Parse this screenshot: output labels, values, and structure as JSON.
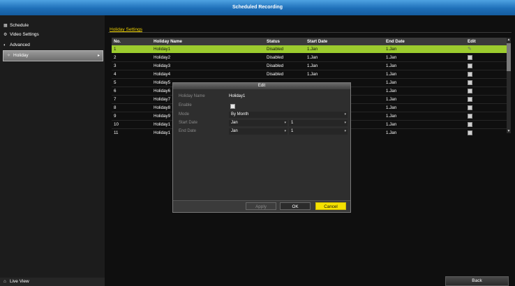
{
  "window": {
    "title": "Scheduled Recording"
  },
  "sidebar": {
    "items": [
      {
        "label": "Schedule",
        "icon": "calendar-icon",
        "glyph": "▦",
        "active": false
      },
      {
        "label": "Video Settings",
        "icon": "gear-icon",
        "glyph": "⚙",
        "active": false
      },
      {
        "label": "Advanced",
        "icon": "advanced-icon",
        "glyph": "◐",
        "active": false
      },
      {
        "label": "Holiday",
        "icon": "holiday-icon",
        "glyph": "✧",
        "active": true,
        "arrow": "▸"
      }
    ],
    "live_view": {
      "label": "Live View",
      "icon": "home-icon",
      "glyph": "⌂"
    }
  },
  "main": {
    "section_title": "Holiday Settings",
    "table": {
      "headers": [
        "No.",
        "Holiday Name",
        "Status",
        "Start Date",
        "End Date",
        "Edit"
      ],
      "rows": [
        {
          "no": "1",
          "name": "Holiday1",
          "status": "Disabled",
          "start": "1.Jan",
          "end": "1.Jan",
          "selected": true
        },
        {
          "no": "2",
          "name": "Holiday2",
          "status": "Disabled",
          "start": "1.Jan",
          "end": "1.Jan"
        },
        {
          "no": "3",
          "name": "Holiday3",
          "status": "Disabled",
          "start": "1.Jan",
          "end": "1.Jan"
        },
        {
          "no": "4",
          "name": "Holiday4",
          "status": "Disabled",
          "start": "1.Jan",
          "end": "1.Jan"
        },
        {
          "no": "5",
          "name": "Holiday5",
          "status": "",
          "start": "",
          "end": "1.Jan"
        },
        {
          "no": "6",
          "name": "Holiday6",
          "status": "",
          "start": "",
          "end": "1.Jan"
        },
        {
          "no": "7",
          "name": "Holiday7",
          "status": "",
          "start": "",
          "end": "1.Jan"
        },
        {
          "no": "8",
          "name": "Holiday8",
          "status": "",
          "start": "",
          "end": "1.Jan"
        },
        {
          "no": "9",
          "name": "Holiday9",
          "status": "",
          "start": "",
          "end": "1.Jan"
        },
        {
          "no": "10",
          "name": "Holiday1",
          "status": "",
          "start": "",
          "end": "1.Jan"
        },
        {
          "no": "11",
          "name": "Holiday1",
          "status": "",
          "start": "",
          "end": "1.Jan"
        }
      ]
    },
    "back_label": "Back"
  },
  "dialog": {
    "title": "Edit",
    "fields": {
      "holiday_name_label": "Holiday Name",
      "holiday_name_value": "Holiday1",
      "enable_label": "Enable",
      "mode_label": "Mode",
      "mode_value": "By Month",
      "start_date_label": "Start Date",
      "start_month": "Jan",
      "start_day": "1",
      "end_date_label": "End Date",
      "end_month": "Jan",
      "end_day": "1"
    },
    "buttons": {
      "apply": "Apply",
      "ok": "OK",
      "cancel": "Cancel"
    }
  },
  "colors": {
    "title_bar": "#1e6fb8",
    "selected_row": "#9ccc2e",
    "accent_yellow": "#f5e100",
    "section_title": "#f0d200"
  }
}
